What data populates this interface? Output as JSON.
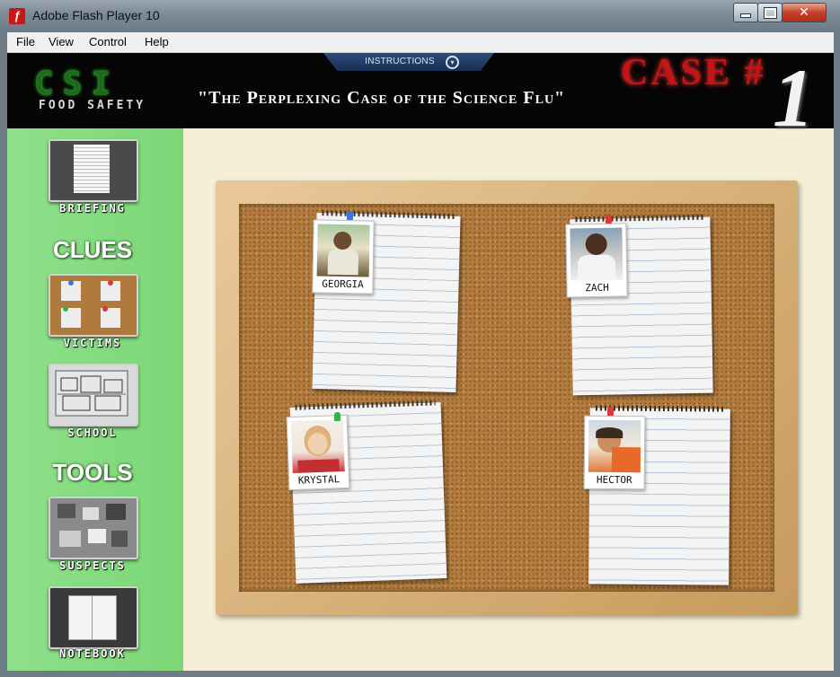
{
  "window": {
    "title": "Adobe Flash Player 10",
    "menu": [
      "File",
      "View",
      "Control",
      "Help"
    ]
  },
  "header": {
    "instructions_label": "INSTRUCTIONS",
    "logo_main": "CSI",
    "logo_sub": "FOOD SAFETY",
    "case_title": "\"The Perplexing Case of the Science Flu\"",
    "case_label": "CASE #",
    "case_number": "1"
  },
  "sidebar": {
    "briefing_label": "BRIEFING",
    "clues_heading": "CLUES",
    "victims_label": "VICTIMS",
    "school_label": "SCHOOL",
    "tools_heading": "TOOLS",
    "suspects_label": "SUSPECTS",
    "notebook_label": "NOTEBOOK"
  },
  "board": {
    "victims": [
      {
        "name": "GEORGIA",
        "pin_color": "#3a78d6"
      },
      {
        "name": "ZACH",
        "pin_color": "#d63a3a"
      },
      {
        "name": "KRYSTAL",
        "pin_color": "#3ab04a"
      },
      {
        "name": "HECTOR",
        "pin_color": "#d63a3a"
      }
    ]
  },
  "colors": {
    "sidebar_green": "#7bd776",
    "stage_background": "#f4efd6",
    "case_red": "#c51414",
    "cork": "#b27b3d"
  }
}
